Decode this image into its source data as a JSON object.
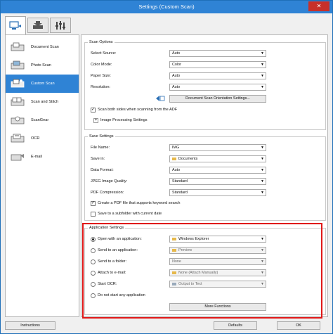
{
  "window": {
    "title": "Settings (Custom Scan)",
    "close_glyph": "✕"
  },
  "tabs": [
    {
      "icon": "scan-from-computer-icon"
    },
    {
      "icon": "scan-from-panel-icon"
    },
    {
      "icon": "general-settings-icon"
    }
  ],
  "sidebar": {
    "items": [
      {
        "label": "Document Scan",
        "icon": "document-scan-icon"
      },
      {
        "label": "Photo Scan",
        "icon": "photo-scan-icon"
      },
      {
        "label": "Custom Scan",
        "icon": "custom-scan-icon",
        "active": true
      },
      {
        "label": "Scan and Stitch",
        "icon": "scan-and-stitch-icon"
      },
      {
        "label": "ScanGear",
        "icon": "scangear-icon"
      },
      {
        "label": "OCR",
        "icon": "ocr-icon"
      },
      {
        "label": "E-mail",
        "icon": "email-icon"
      }
    ]
  },
  "scan_options": {
    "title": "Scan Options",
    "source_label": "Select Source:",
    "source_value": "Auto",
    "color_label": "Color Mode:",
    "color_value": "Color",
    "paper_label": "Paper Size:",
    "paper_value": "Auto",
    "resolution_label": "Resolution:",
    "resolution_value": "Auto",
    "orientation_button": "Document Scan Orientation Settings...",
    "both_sides_label": "Scan both sides when scanning from the ADF",
    "both_sides_checked": true,
    "image_processing_label": "Image Processing Settings"
  },
  "save_settings": {
    "title": "Save Settings",
    "file_name_label": "File Name:",
    "file_name_value": "IMG",
    "save_in_label": "Save in:",
    "save_in_value": "Documents",
    "format_label": "Data Format:",
    "format_value": "Auto",
    "jpeg_label": "JPEG Image Quality:",
    "jpeg_value": "Standard",
    "pdf_label": "PDF Compression:",
    "pdf_value": "Standard",
    "keyword_pdf_label": "Create a PDF file that supports keyword search",
    "keyword_pdf_checked": true,
    "subfolder_label": "Save to a subfolder with current date",
    "subfolder_checked": false
  },
  "app_settings": {
    "title": "Application Settings",
    "open_app_label": "Open with an application:",
    "open_app_value": "Windows Explorer",
    "send_app_label": "Send to an application:",
    "send_app_value": "Preview",
    "send_folder_label": "Send to a folder:",
    "send_folder_value": "None",
    "attach_email_label": "Attach to e-mail:",
    "attach_email_value": "None (Attach Manually)",
    "start_ocr_label": "Start OCR:",
    "start_ocr_value": "Output to Text",
    "no_app_label": "Do not start any application",
    "more_functions_button": "More Functions",
    "selected_option": "open_app"
  },
  "footer": {
    "instructions": "Instructions",
    "defaults": "Defaults",
    "ok": "OK"
  },
  "colors": {
    "accent": "#2f83d5",
    "highlight": "#e01818"
  }
}
